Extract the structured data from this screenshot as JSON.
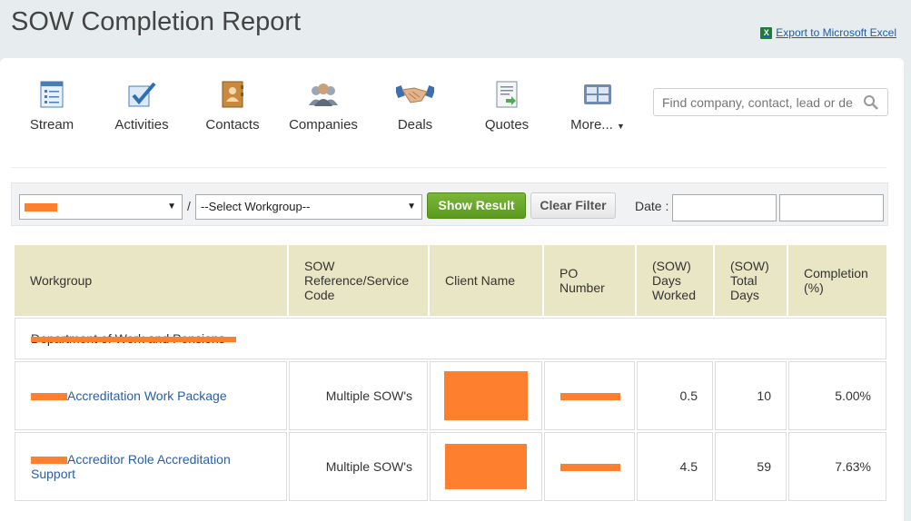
{
  "page": {
    "title": "SOW Completion Report",
    "export_label": "Export to Microsoft Excel",
    "export_icon": "excel-icon"
  },
  "nav": {
    "items": [
      {
        "label": "Stream",
        "icon": "stream-icon"
      },
      {
        "label": "Activities",
        "icon": "checkbox-icon"
      },
      {
        "label": "Contacts",
        "icon": "address-book-icon"
      },
      {
        "label": "Companies",
        "icon": "people-icon"
      },
      {
        "label": "Deals",
        "icon": "handshake-icon"
      },
      {
        "label": "Quotes",
        "icon": "document-icon"
      },
      {
        "label": "More...",
        "icon": "grid-icon"
      }
    ],
    "search_placeholder": "Find company, contact, lead or de"
  },
  "filters": {
    "workgroup_select": "--Select Workgroup--",
    "separator": "/",
    "show_label": "Show Result",
    "clear_label": "Clear Filter",
    "date_label": "Date :"
  },
  "table": {
    "headers": [
      "Workgroup",
      "SOW Reference/Service Code",
      "Client Name",
      "PO Number",
      "(SOW) Days Worked",
      "(SOW) Total Days",
      "Completion (%)"
    ],
    "group_label": "Department of Work and Pensions",
    "rows": [
      {
        "workgroup": "Accreditation Work Package",
        "sow": "Multiple SOW's",
        "days_worked": "0.5",
        "total_days": "10",
        "completion": "5.00%"
      },
      {
        "workgroup": "Accreditor Role Accreditation Support",
        "sow": "Multiple SOW's",
        "days_worked": "4.5",
        "total_days": "59",
        "completion": "7.63%"
      }
    ]
  },
  "colors": {
    "accent_green": "#6aa82b",
    "header_bg": "#e8e6c4",
    "redaction": "#fe7f2d",
    "link": "#2a5ea6"
  }
}
